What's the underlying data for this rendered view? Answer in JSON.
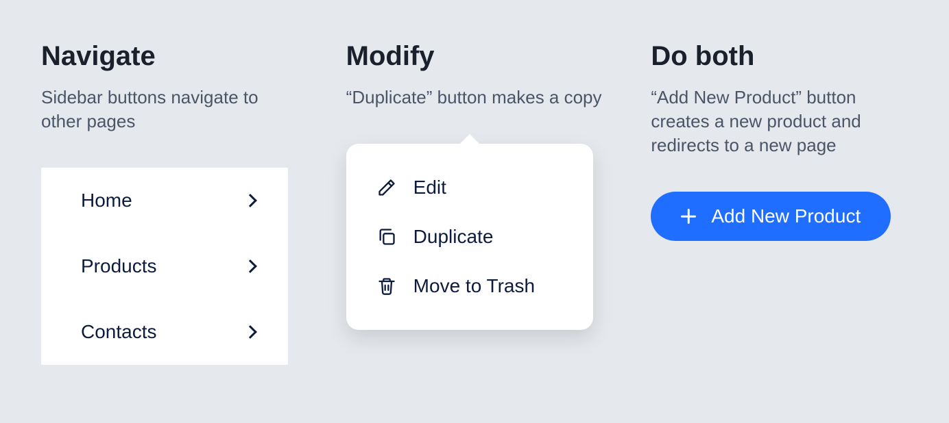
{
  "navigate": {
    "heading": "Navigate",
    "description": "Sidebar buttons navigate to other pages",
    "items": [
      {
        "label": "Home"
      },
      {
        "label": "Products"
      },
      {
        "label": "Contacts"
      }
    ]
  },
  "modify": {
    "heading": "Modify",
    "description": "“Duplicate” button makes a copy",
    "menu": [
      {
        "label": "Edit",
        "icon": "pencil-icon"
      },
      {
        "label": "Duplicate",
        "icon": "copy-icon"
      },
      {
        "label": "Move to Trash",
        "icon": "trash-icon"
      }
    ]
  },
  "both": {
    "heading": "Do both",
    "description": "“Add New Product” button creates a new product and redirects to a new page",
    "cta_label": "Add New Product"
  }
}
